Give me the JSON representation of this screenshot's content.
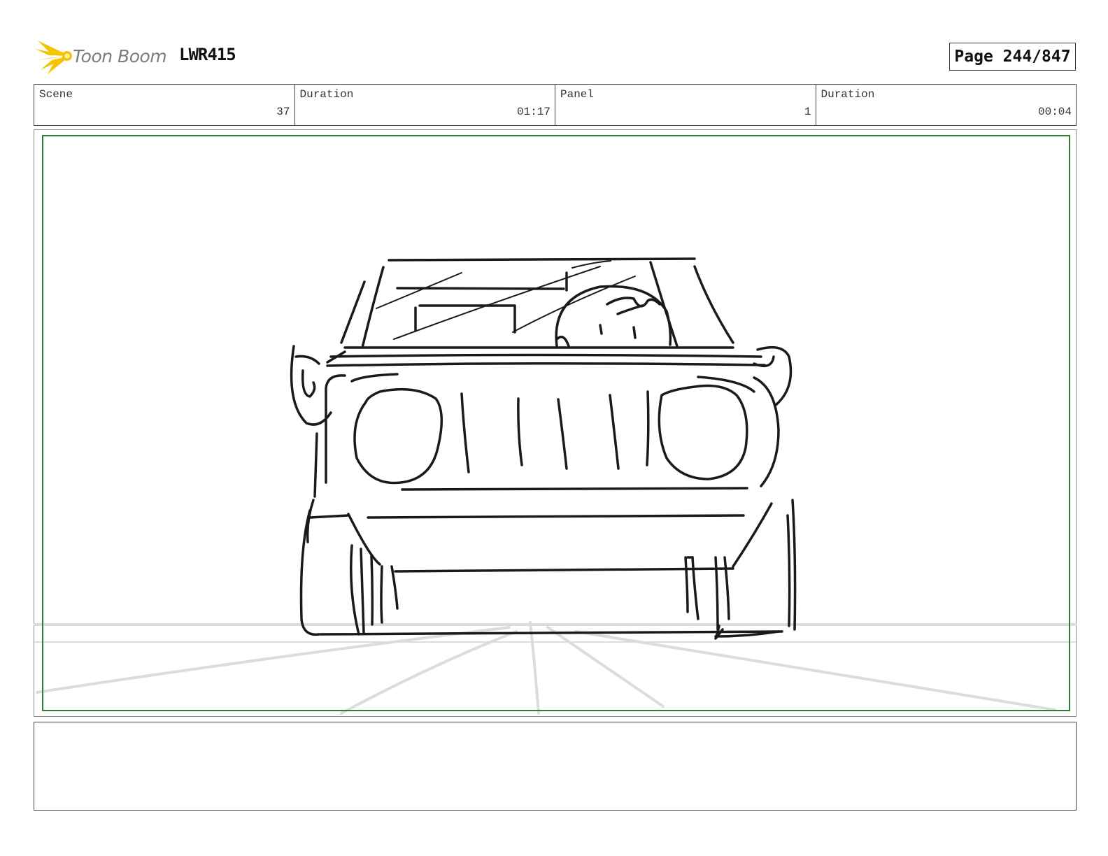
{
  "header": {
    "logo_text": "Toon Boom",
    "project": "LWR415",
    "page": "Page 244/847"
  },
  "info": {
    "scene_label": "Scene",
    "scene_value": "37",
    "scene_duration_label": "Duration",
    "scene_duration_value": "01:17",
    "panel_label": "Panel",
    "panel_value": "1",
    "panel_duration_label": "Duration",
    "panel_duration_value": "00:04"
  },
  "icons": {
    "logo": "starburst-logo-icon"
  },
  "colors": {
    "logo_yellow": "#f5c400",
    "safe_frame": "#2e7d32",
    "sketch_line": "#1a1a1a",
    "guide_line": "#dcdcdc"
  },
  "notes": ""
}
